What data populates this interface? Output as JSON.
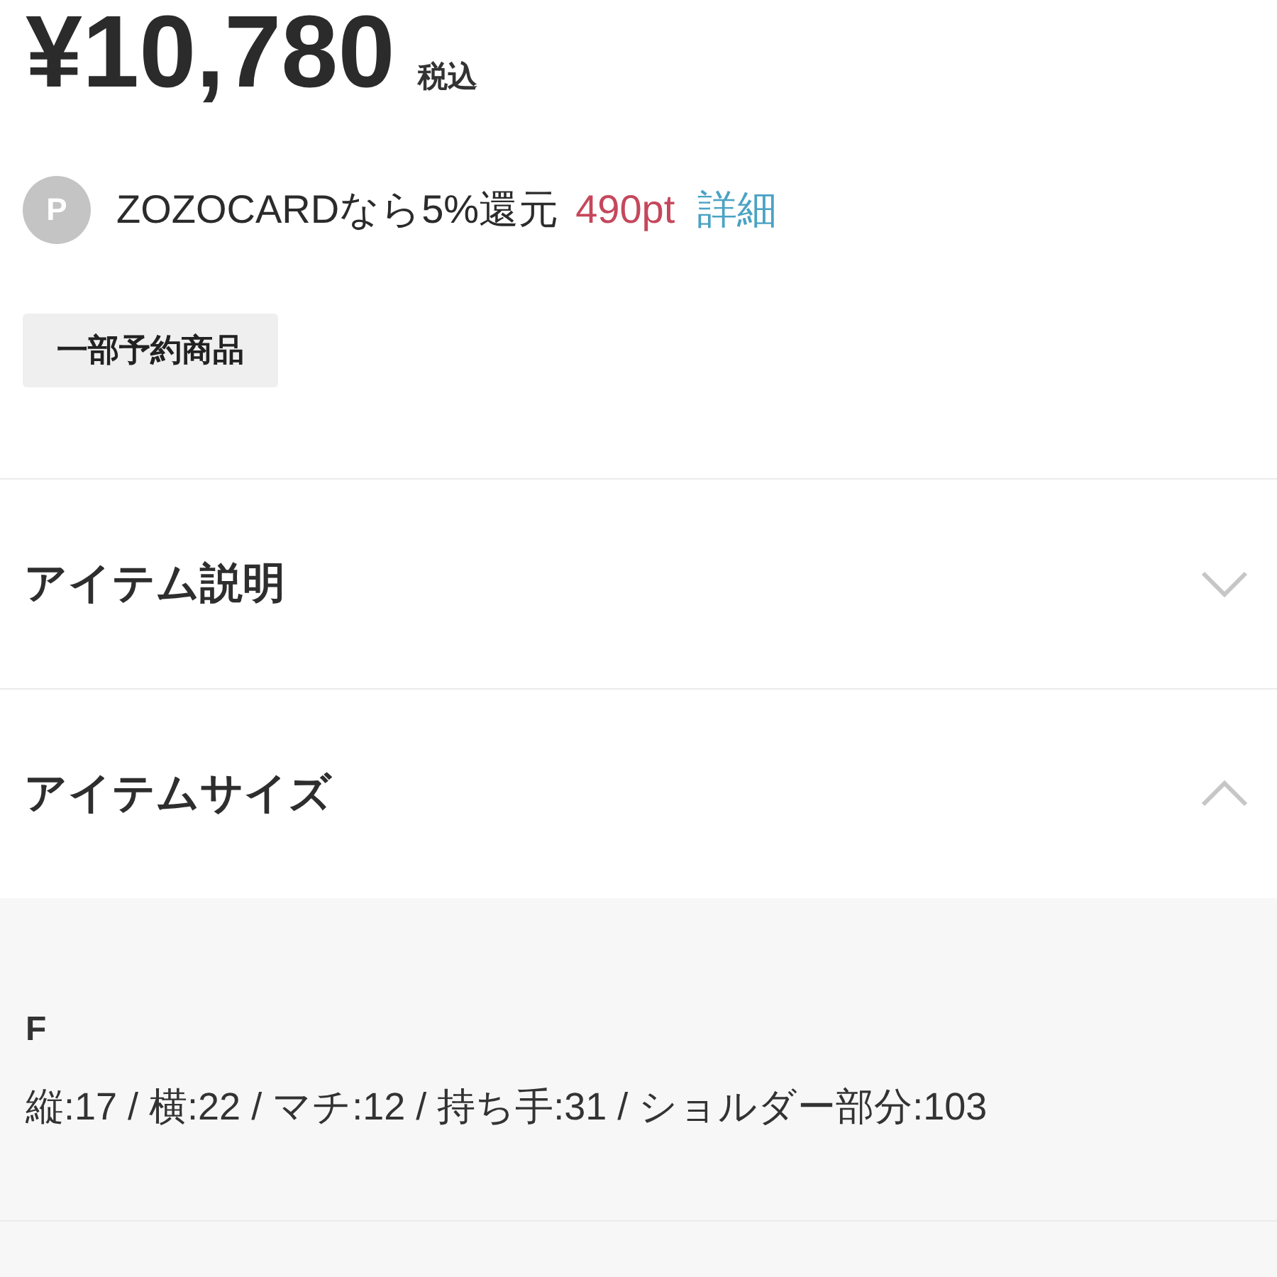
{
  "price": {
    "amount": "¥10,780",
    "tax_note": "税込"
  },
  "points": {
    "icon_letter": "P",
    "text": "ZOZOCARDなら5%還元",
    "points": "490pt",
    "link": "詳細"
  },
  "tag": "一部予約商品",
  "sections": [
    {
      "title": "アイテム説明",
      "expanded": false
    },
    {
      "title": "アイテムサイズ",
      "expanded": true,
      "sizes": [
        {
          "label": "F",
          "dimensions": "縦:17 / 横:22 / マチ:12 / 持ち手:31 / ショルダー部分:103"
        }
      ]
    }
  ]
}
